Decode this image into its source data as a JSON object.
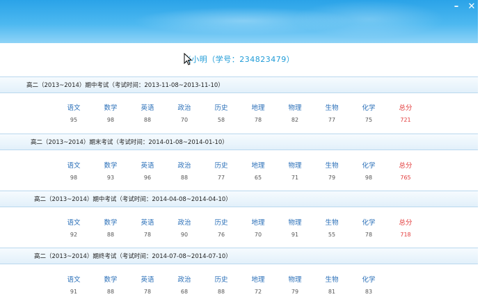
{
  "window": {
    "minimize_label": "–",
    "close_label": "✕"
  },
  "student": {
    "label": "张小明（学号：234823479）"
  },
  "subject_headers": [
    "语文",
    "数学",
    "英语",
    "政治",
    "历史",
    "地理",
    "物理",
    "生物",
    "化学",
    "总分"
  ],
  "exams": [
    {
      "title": "高二（2013~2014）期中考试（考试时间：2013-11-08~2013-11-10）",
      "scores": [
        "95",
        "98",
        "88",
        "70",
        "58",
        "78",
        "82",
        "77",
        "75",
        "721"
      ]
    },
    {
      "title": "高二（2013~2014）期末考试（考试时间：2014-01-08~2014-01-10）",
      "scores": [
        "98",
        "93",
        "96",
        "88",
        "77",
        "65",
        "71",
        "79",
        "98",
        "765"
      ]
    },
    {
      "title": "高二（2013~2014）期中考试（考试时间：2014-04-08~2014-04-10）",
      "scores": [
        "92",
        "88",
        "78",
        "90",
        "76",
        "70",
        "91",
        "55",
        "78",
        "718"
      ]
    },
    {
      "title": "高二（2013~2014）期终考试（考试时间：2014-07-08~2014-07-10）",
      "scores": [
        "91",
        "88",
        "78",
        "68",
        "88",
        "72",
        "79",
        "81",
        "83",
        ""
      ]
    }
  ],
  "colors": {
    "title_bar": "#2aa3e8",
    "subject_text": "#2a6fb8",
    "total_text": "#e23a3a",
    "student_text": "#1e9bd7"
  }
}
